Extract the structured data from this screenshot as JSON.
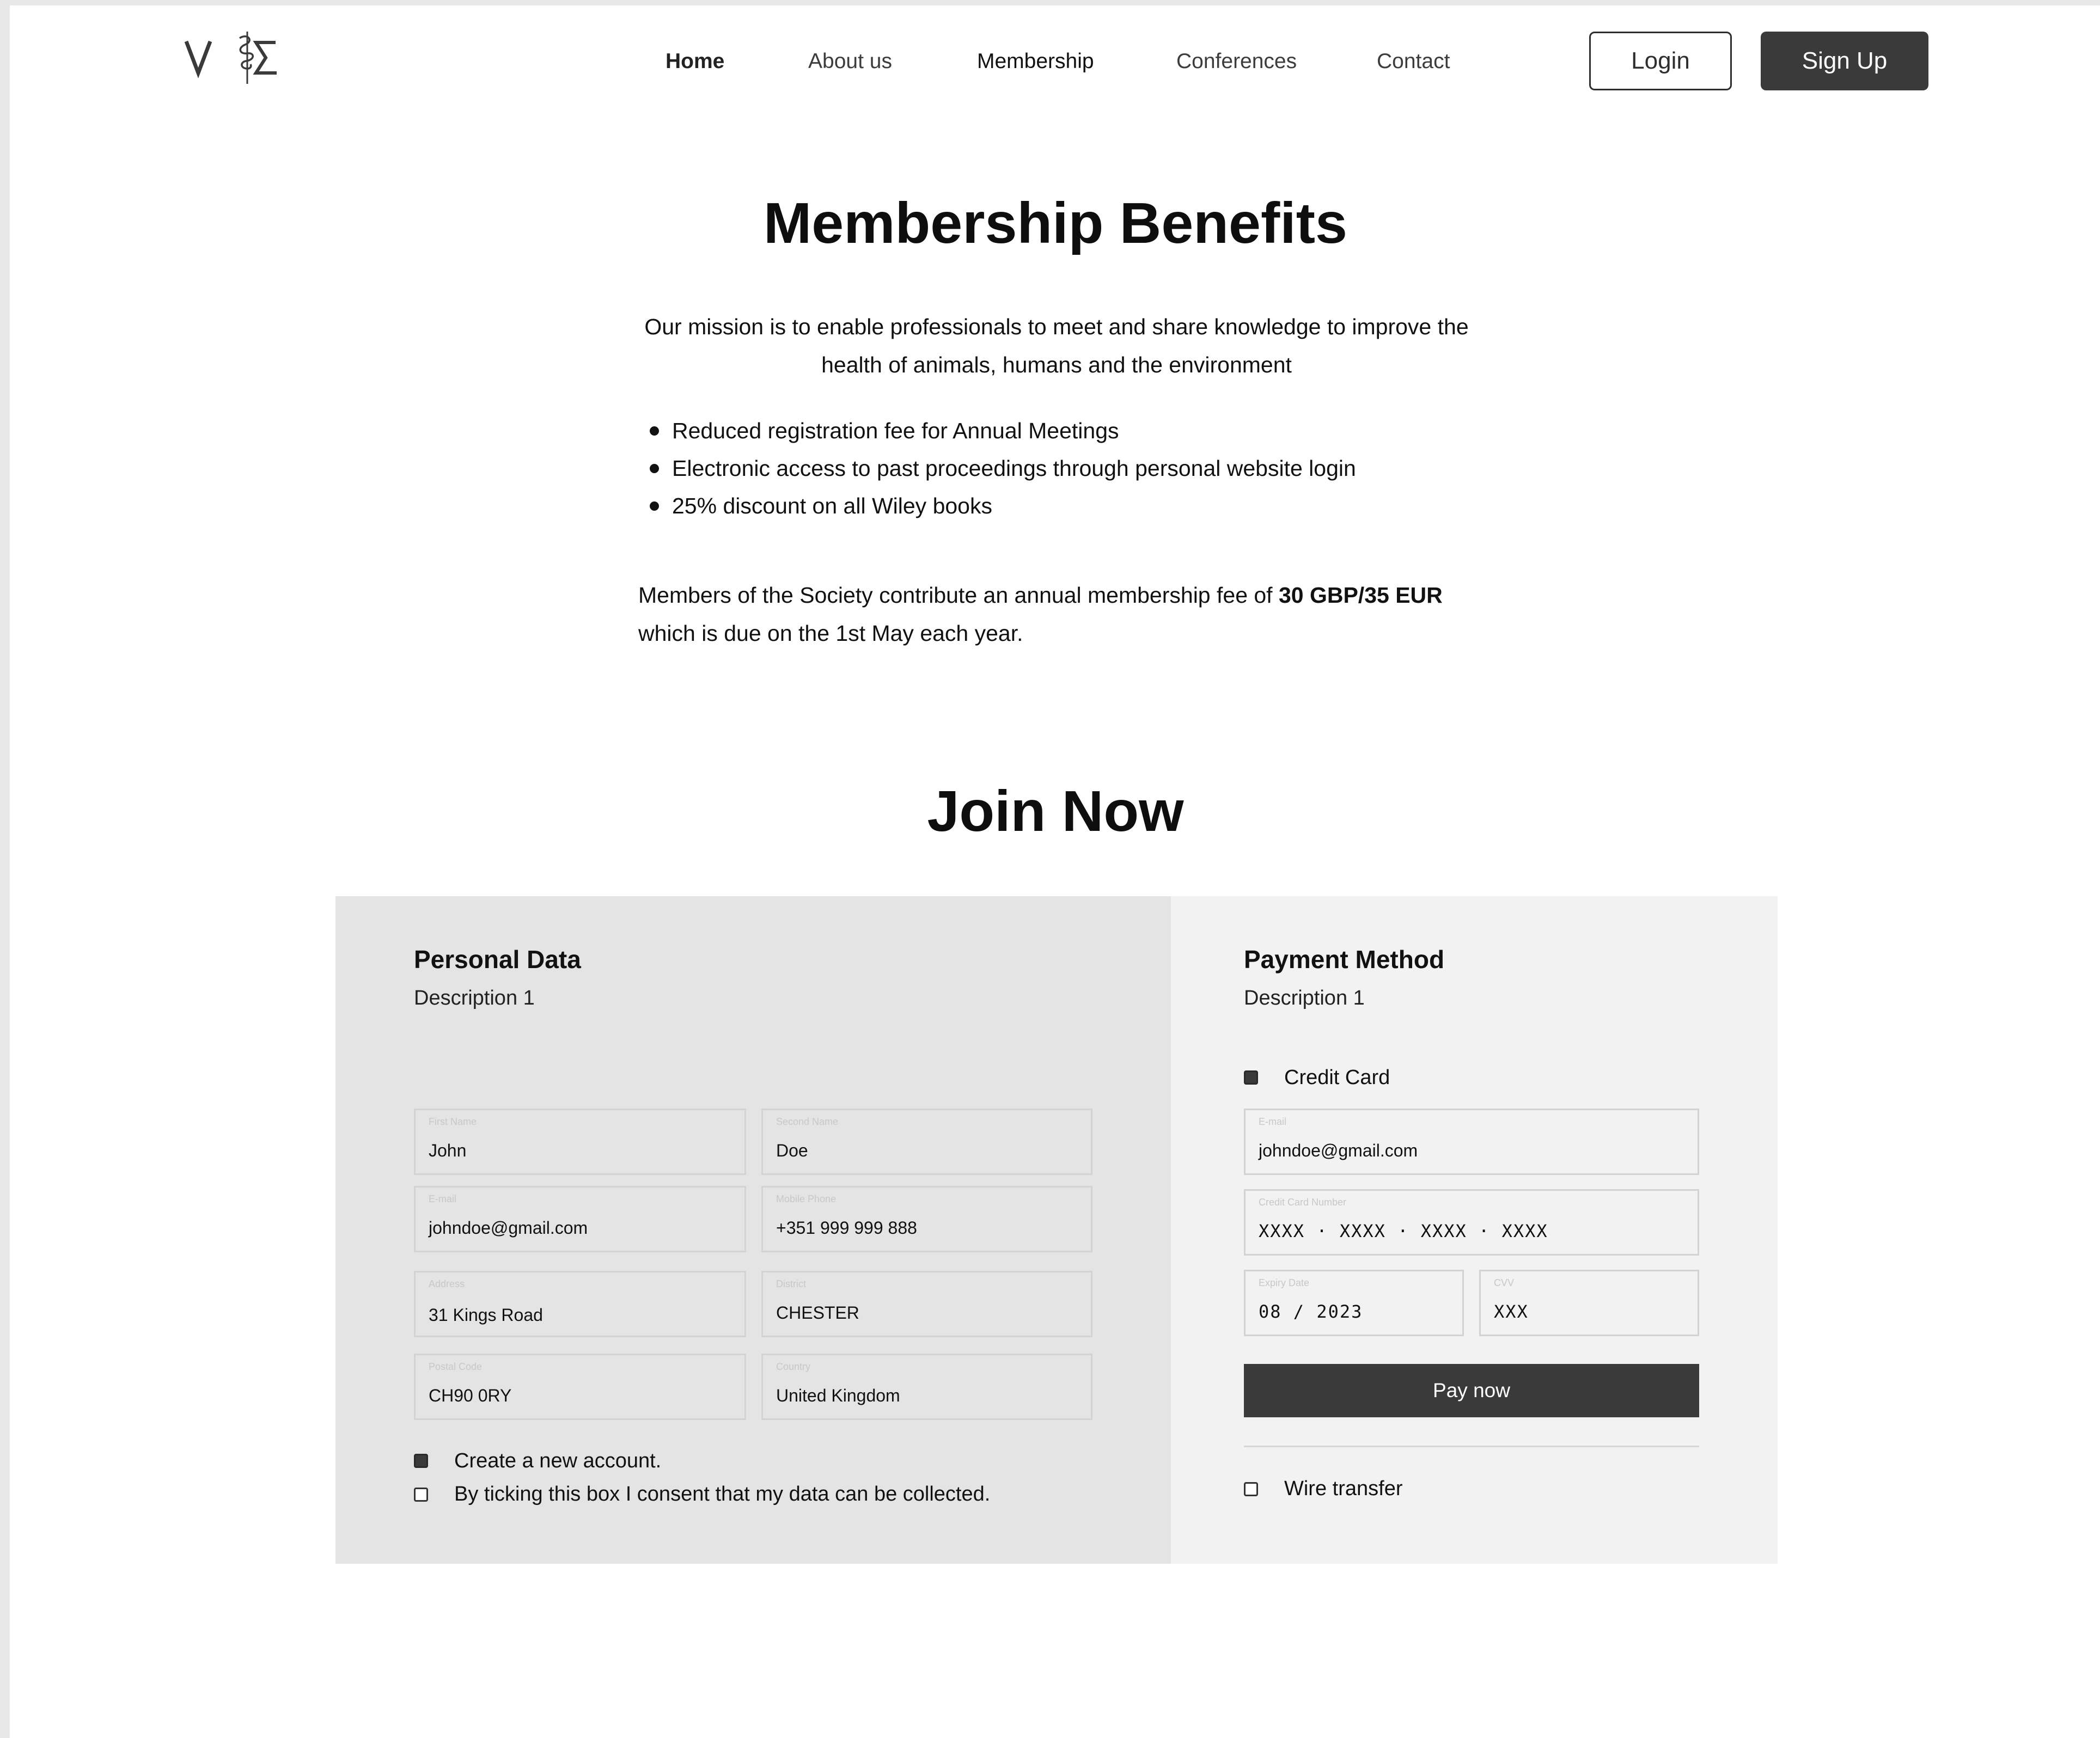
{
  "header": {
    "logo_alt": "VΣ",
    "nav": [
      {
        "label": "Home"
      },
      {
        "label": "About us"
      },
      {
        "label": "Membership"
      },
      {
        "label": "Conferences"
      },
      {
        "label": "Contact"
      }
    ],
    "login_label": "Login",
    "signup_label": "Sign Up"
  },
  "benefits": {
    "title": "Membership Benefits",
    "mission": "Our mission is to enable professionals to meet and share knowledge to improve the health of animals, humans and the environment",
    "items": [
      "Reduced registration fee for Annual Meetings",
      "Electronic access to past proceedings through personal website login",
      "25% discount on all Wiley books"
    ],
    "fee_prefix": "Members of the Society contribute an annual membership fee of ",
    "fee_amount": "30 GBP/35 EUR",
    "fee_suffix": "which is due on the 1st May each year."
  },
  "join": {
    "title": "Join Now",
    "personal": {
      "title": "Personal Data",
      "description": "Description 1",
      "fields": {
        "first_name": {
          "label": "First Name",
          "value": "John"
        },
        "second_name": {
          "label": "Second Name",
          "value": "Doe"
        },
        "email": {
          "label": "E-mail",
          "value": "johndoe@gmail.com"
        },
        "mobile": {
          "label": "Mobile Phone",
          "value": "+351 999 999 888"
        },
        "address": {
          "label": "Address",
          "value": "31 Kings Road"
        },
        "district": {
          "label": "District",
          "value": "CHESTER"
        },
        "postal": {
          "label": "Postal Code",
          "value": "CH90 0RY"
        },
        "country": {
          "label": "Country",
          "value": "United Kingdom"
        }
      },
      "create_account": {
        "label": "Create a new account.",
        "checked": true
      },
      "consent": {
        "label": "By ticking this box I consent that my data can be collected.",
        "checked": false
      }
    },
    "payment": {
      "title": "Payment Method",
      "description": "Description 1",
      "credit_card": {
        "label": "Credit Card",
        "checked": true
      },
      "fields": {
        "email": {
          "label": "E-mail",
          "value": "johndoe@gmail.com"
        },
        "card_number": {
          "label": "Credit Card Number",
          "value": "XXXX · XXXX · XXXX · XXXX"
        },
        "expiry": {
          "label": "Expiry Date",
          "value": "08 / 2023"
        },
        "cvv": {
          "label": "CVV",
          "value": "XXX"
        }
      },
      "pay_label": "Pay now",
      "wire": {
        "label": "Wire transfer",
        "checked": false
      }
    }
  },
  "colors": {
    "dark": "#3a3a3a",
    "panel_left": "#e4e4e4",
    "panel_right": "#f2f2f2",
    "field_border": "#d3d3d3"
  }
}
